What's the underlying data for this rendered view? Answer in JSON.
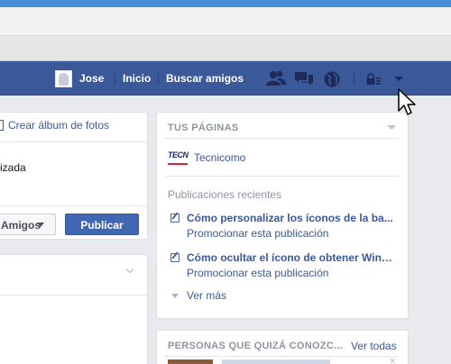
{
  "header": {
    "user_name": "Jose",
    "nav_home": "Inicio",
    "nav_find_friends": "Buscar amigos",
    "icons": [
      "friend-requests-icon",
      "messages-icon",
      "notifications-globe-icon",
      "privacy-lock-icon",
      "account-menu-arrow-icon"
    ]
  },
  "composer": {
    "create_album_label": "Crear álbum de fotos",
    "status_fragment": "izada",
    "audience_label": "Amigos",
    "publish_label": "Publicar"
  },
  "pages_widget": {
    "title": "TUS PÁGINAS",
    "page_logo_text": "TECN",
    "page_name": "Tecnicomo",
    "recent_posts_title": "Publicaciones recientes",
    "posts": [
      {
        "title": "Cómo personalizar los íconos de la ba...",
        "action": "Promocionar esta publicación"
      },
      {
        "title": "Cómo ocultar el ícono de obtener Wind...",
        "action": "Promocionar esta publicación"
      }
    ],
    "see_more_label": "Ver más"
  },
  "people_widget": {
    "title": "PERSONAS QUE QUIZÁ CONOZC...",
    "see_all_label": "Ver todas"
  },
  "colors": {
    "bluebar": "#3b5998",
    "link": "#3b5998",
    "publish_button": "#4267b2",
    "background": "#e9eaed"
  }
}
